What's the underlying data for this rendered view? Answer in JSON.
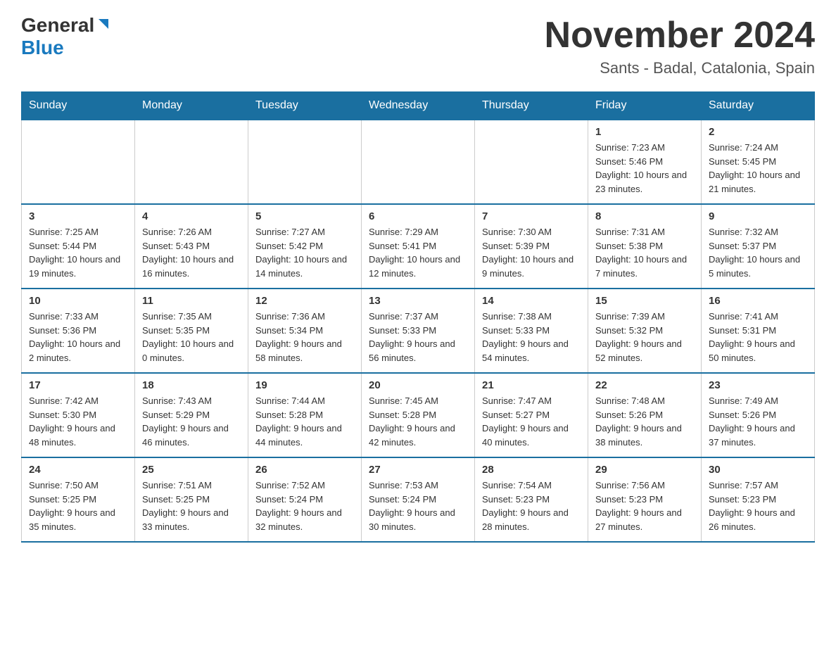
{
  "header": {
    "logo_general": "General",
    "logo_blue": "Blue",
    "title": "November 2024",
    "subtitle": "Sants - Badal, Catalonia, Spain"
  },
  "days_of_week": [
    "Sunday",
    "Monday",
    "Tuesday",
    "Wednesday",
    "Thursday",
    "Friday",
    "Saturday"
  ],
  "weeks": [
    [
      {
        "day": "",
        "info": ""
      },
      {
        "day": "",
        "info": ""
      },
      {
        "day": "",
        "info": ""
      },
      {
        "day": "",
        "info": ""
      },
      {
        "day": "",
        "info": ""
      },
      {
        "day": "1",
        "info": "Sunrise: 7:23 AM\nSunset: 5:46 PM\nDaylight: 10 hours and 23 minutes."
      },
      {
        "day": "2",
        "info": "Sunrise: 7:24 AM\nSunset: 5:45 PM\nDaylight: 10 hours and 21 minutes."
      }
    ],
    [
      {
        "day": "3",
        "info": "Sunrise: 7:25 AM\nSunset: 5:44 PM\nDaylight: 10 hours and 19 minutes."
      },
      {
        "day": "4",
        "info": "Sunrise: 7:26 AM\nSunset: 5:43 PM\nDaylight: 10 hours and 16 minutes."
      },
      {
        "day": "5",
        "info": "Sunrise: 7:27 AM\nSunset: 5:42 PM\nDaylight: 10 hours and 14 minutes."
      },
      {
        "day": "6",
        "info": "Sunrise: 7:29 AM\nSunset: 5:41 PM\nDaylight: 10 hours and 12 minutes."
      },
      {
        "day": "7",
        "info": "Sunrise: 7:30 AM\nSunset: 5:39 PM\nDaylight: 10 hours and 9 minutes."
      },
      {
        "day": "8",
        "info": "Sunrise: 7:31 AM\nSunset: 5:38 PM\nDaylight: 10 hours and 7 minutes."
      },
      {
        "day": "9",
        "info": "Sunrise: 7:32 AM\nSunset: 5:37 PM\nDaylight: 10 hours and 5 minutes."
      }
    ],
    [
      {
        "day": "10",
        "info": "Sunrise: 7:33 AM\nSunset: 5:36 PM\nDaylight: 10 hours and 2 minutes."
      },
      {
        "day": "11",
        "info": "Sunrise: 7:35 AM\nSunset: 5:35 PM\nDaylight: 10 hours and 0 minutes."
      },
      {
        "day": "12",
        "info": "Sunrise: 7:36 AM\nSunset: 5:34 PM\nDaylight: 9 hours and 58 minutes."
      },
      {
        "day": "13",
        "info": "Sunrise: 7:37 AM\nSunset: 5:33 PM\nDaylight: 9 hours and 56 minutes."
      },
      {
        "day": "14",
        "info": "Sunrise: 7:38 AM\nSunset: 5:33 PM\nDaylight: 9 hours and 54 minutes."
      },
      {
        "day": "15",
        "info": "Sunrise: 7:39 AM\nSunset: 5:32 PM\nDaylight: 9 hours and 52 minutes."
      },
      {
        "day": "16",
        "info": "Sunrise: 7:41 AM\nSunset: 5:31 PM\nDaylight: 9 hours and 50 minutes."
      }
    ],
    [
      {
        "day": "17",
        "info": "Sunrise: 7:42 AM\nSunset: 5:30 PM\nDaylight: 9 hours and 48 minutes."
      },
      {
        "day": "18",
        "info": "Sunrise: 7:43 AM\nSunset: 5:29 PM\nDaylight: 9 hours and 46 minutes."
      },
      {
        "day": "19",
        "info": "Sunrise: 7:44 AM\nSunset: 5:28 PM\nDaylight: 9 hours and 44 minutes."
      },
      {
        "day": "20",
        "info": "Sunrise: 7:45 AM\nSunset: 5:28 PM\nDaylight: 9 hours and 42 minutes."
      },
      {
        "day": "21",
        "info": "Sunrise: 7:47 AM\nSunset: 5:27 PM\nDaylight: 9 hours and 40 minutes."
      },
      {
        "day": "22",
        "info": "Sunrise: 7:48 AM\nSunset: 5:26 PM\nDaylight: 9 hours and 38 minutes."
      },
      {
        "day": "23",
        "info": "Sunrise: 7:49 AM\nSunset: 5:26 PM\nDaylight: 9 hours and 37 minutes."
      }
    ],
    [
      {
        "day": "24",
        "info": "Sunrise: 7:50 AM\nSunset: 5:25 PM\nDaylight: 9 hours and 35 minutes."
      },
      {
        "day": "25",
        "info": "Sunrise: 7:51 AM\nSunset: 5:25 PM\nDaylight: 9 hours and 33 minutes."
      },
      {
        "day": "26",
        "info": "Sunrise: 7:52 AM\nSunset: 5:24 PM\nDaylight: 9 hours and 32 minutes."
      },
      {
        "day": "27",
        "info": "Sunrise: 7:53 AM\nSunset: 5:24 PM\nDaylight: 9 hours and 30 minutes."
      },
      {
        "day": "28",
        "info": "Sunrise: 7:54 AM\nSunset: 5:23 PM\nDaylight: 9 hours and 28 minutes."
      },
      {
        "day": "29",
        "info": "Sunrise: 7:56 AM\nSunset: 5:23 PM\nDaylight: 9 hours and 27 minutes."
      },
      {
        "day": "30",
        "info": "Sunrise: 7:57 AM\nSunset: 5:23 PM\nDaylight: 9 hours and 26 minutes."
      }
    ]
  ]
}
